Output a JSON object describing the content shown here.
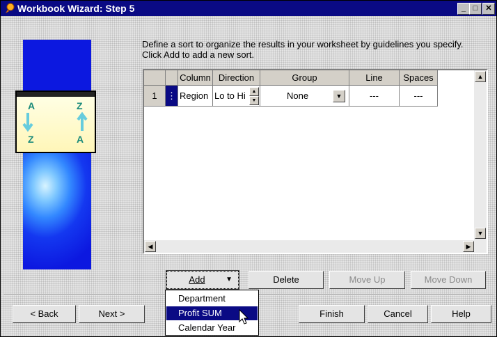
{
  "window": {
    "title": "Workbook Wizard: Step 5"
  },
  "description": "Define a sort to organize the results in your worksheet by guidelines you specify. Click Add to add a new sort.",
  "sort_grid": {
    "columns": [
      "Column",
      "Direction",
      "Group",
      "Line",
      "Spaces"
    ],
    "rows": [
      {
        "num": "1",
        "column": "Region",
        "direction": "Lo to Hi",
        "group": "None",
        "line": "---",
        "spaces": "---"
      }
    ]
  },
  "side_image": {
    "letters": [
      "A",
      "Z",
      "Z",
      "A"
    ]
  },
  "buttons": {
    "add": "Add",
    "delete": "Delete",
    "move_up": "Move Up",
    "move_down": "Move Down",
    "back": "< Back",
    "next": "Next >",
    "finish": "Finish",
    "cancel": "Cancel",
    "help": "Help"
  },
  "add_menu": {
    "options": [
      "Department",
      "Profit SUM",
      "Calendar Year"
    ],
    "selected": "Profit SUM"
  },
  "colors": {
    "titlebar": "#0a0a84",
    "selection": "#0a0a84"
  },
  "icons": [
    "app-icon",
    "minimize-icon",
    "maximize-icon",
    "close-icon",
    "spin-up-icon",
    "spin-down-icon",
    "dropdown-arrow-icon",
    "scroll-up-icon",
    "scroll-down-icon",
    "scroll-left-icon",
    "scroll-right-icon",
    "mouse-cursor-icon"
  ]
}
